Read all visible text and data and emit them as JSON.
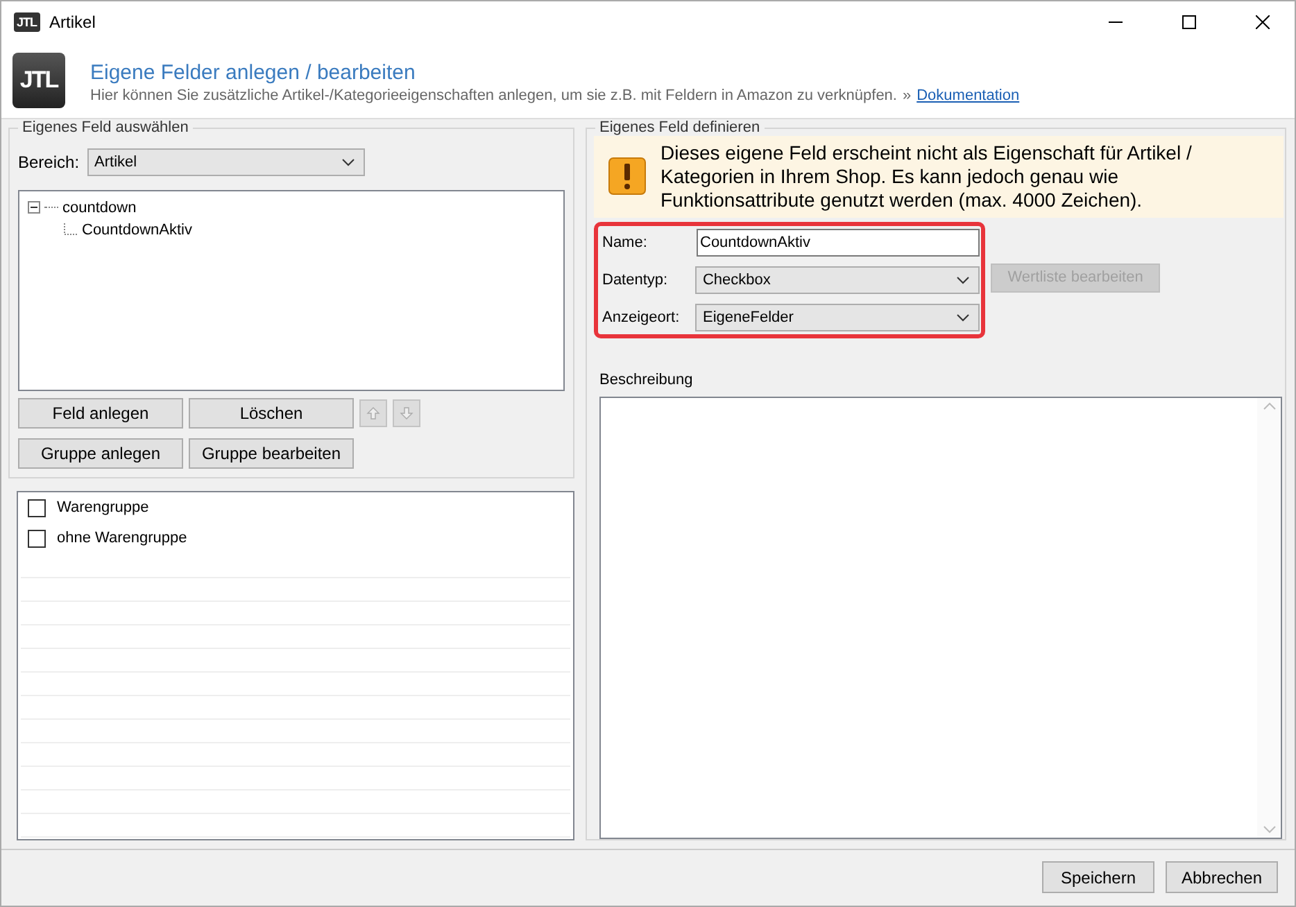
{
  "window": {
    "icon_text": "JTL",
    "title": "Artikel"
  },
  "header": {
    "logo_text": "JTL",
    "title": "Eigene Felder anlegen / bearbeiten",
    "description": "Hier können Sie zusätzliche Artikel-/Kategorieeigenschaften anlegen, um sie z.B. mit Feldern in Amazon zu verknüpfen.",
    "link_prefix": "»",
    "link": "Dokumentation"
  },
  "left_group": {
    "title": "Eigenes Feld auswählen",
    "bereich_label": "Bereich:",
    "bereich_value": "Artikel",
    "tree": [
      {
        "label": "countdown",
        "expanded": true,
        "children": [
          {
            "label": "CountdownAktiv"
          }
        ]
      }
    ],
    "buttons": [
      {
        "kind": "text",
        "label": "Feld anlegen",
        "disabled": false
      },
      {
        "kind": "text",
        "label": "Löschen",
        "disabled": false
      },
      {
        "kind": "up",
        "disabled": true
      },
      {
        "kind": "down",
        "disabled": true
      },
      {
        "kind": "text",
        "label": "Gruppe anlegen",
        "disabled": false
      },
      {
        "kind": "text",
        "label": "Gruppe bearbeiten",
        "disabled": false
      }
    ]
  },
  "category_list": [
    {
      "label": "Warengruppe",
      "checked": false
    },
    {
      "label": "ohne Warengruppe",
      "checked": false
    }
  ],
  "right_group": {
    "title": "Eigenes Feld definieren",
    "warning": "Dieses eigene Feld erscheint nicht als Eigenschaft für Artikel / Kategorien in Ihrem Shop. Es kann jedoch genau wie Funktionsattribute genutzt werden (max. 4000 Zeichen).",
    "highlighted": true,
    "fields": [
      {
        "kind": "text",
        "label": "Name:",
        "value": "CountdownAktiv"
      },
      {
        "kind": "select",
        "label": "Datentyp:",
        "value": "Checkbox"
      },
      {
        "kind": "select",
        "label": "Anzeigeort:",
        "value": "EigeneFelder"
      }
    ],
    "side_button": {
      "label": "Wertliste bearbeiten",
      "disabled": true
    },
    "description_label": "Beschreibung"
  },
  "footer": {
    "buttons": [
      "Speichern",
      "Abbrechen"
    ]
  }
}
